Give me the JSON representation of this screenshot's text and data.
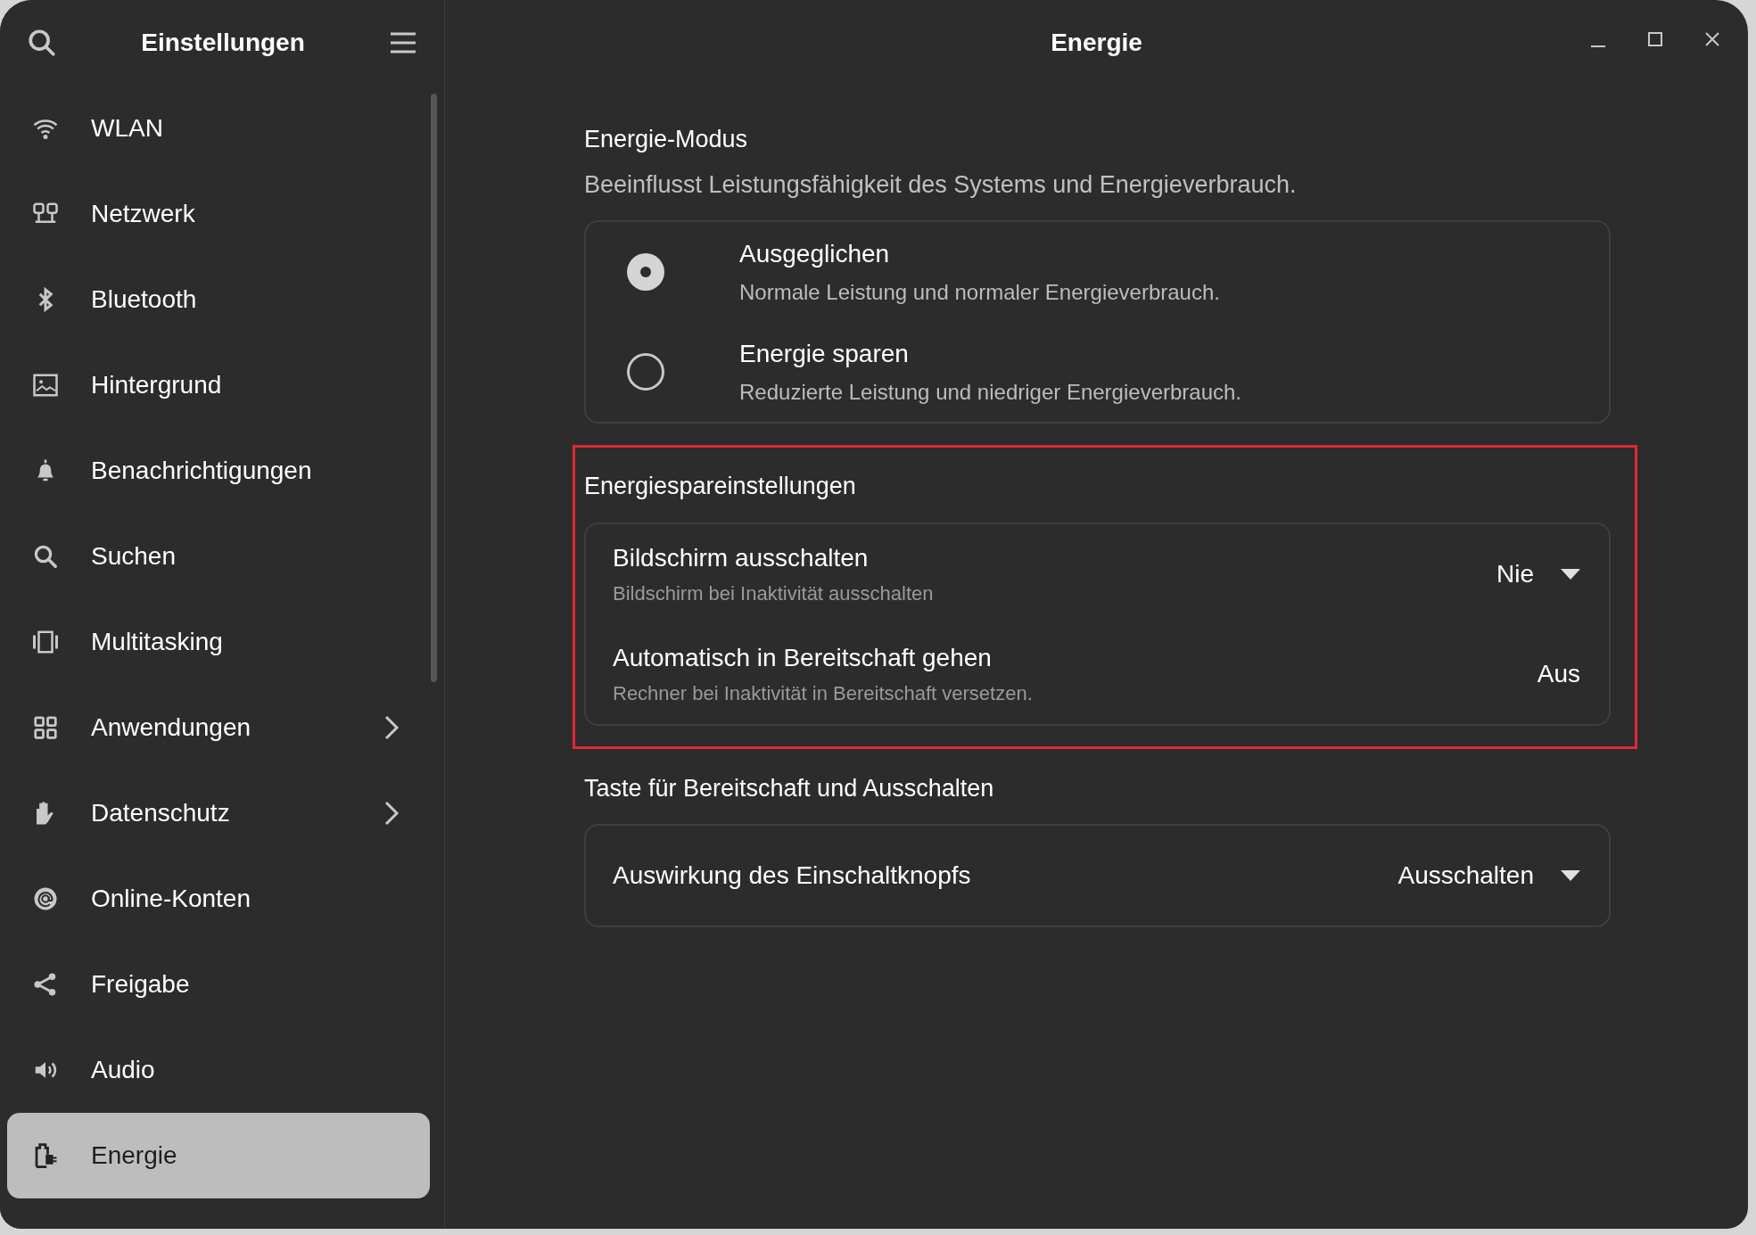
{
  "sidebar": {
    "title": "Einstellungen",
    "items": [
      {
        "label": "WLAN",
        "submenu": false,
        "selected": false
      },
      {
        "label": "Netzwerk",
        "submenu": false,
        "selected": false
      },
      {
        "label": "Bluetooth",
        "submenu": false,
        "selected": false
      },
      {
        "label": "Hintergrund",
        "submenu": false,
        "selected": false
      },
      {
        "label": "Benachrichtigungen",
        "submenu": false,
        "selected": false
      },
      {
        "label": "Suchen",
        "submenu": false,
        "selected": false
      },
      {
        "label": "Multitasking",
        "submenu": false,
        "selected": false
      },
      {
        "label": "Anwendungen",
        "submenu": true,
        "selected": false
      },
      {
        "label": "Datenschutz",
        "submenu": true,
        "selected": false
      },
      {
        "label": "Online-Konten",
        "submenu": false,
        "selected": false
      },
      {
        "label": "Freigabe",
        "submenu": false,
        "selected": false
      },
      {
        "label": "Audio",
        "submenu": false,
        "selected": false
      },
      {
        "label": "Energie",
        "submenu": false,
        "selected": true
      }
    ]
  },
  "main": {
    "title": "Energie",
    "sections": [
      {
        "kind": "radio",
        "heading": "Energie-Modus",
        "description": "Beeinflusst Leistungsfähigkeit des Systems und Energieverbrauch.",
        "highlighted": false,
        "options": [
          {
            "title": "Ausgeglichen",
            "subtitle": "Normale Leistung und normaler Energieverbrauch.",
            "selected": true
          },
          {
            "title": "Energie sparen",
            "subtitle": "Reduzierte Leistung und niedriger Energieverbrauch.",
            "selected": false
          }
        ]
      },
      {
        "kind": "rows",
        "heading": "Energiespareinstellungen",
        "highlighted": true,
        "rows": [
          {
            "title": "Bildschirm ausschalten",
            "subtitle": "Bildschirm bei Inaktivität ausschalten",
            "value": "Nie",
            "dropdown": true
          },
          {
            "title": "Automatisch in Bereitschaft gehen",
            "subtitle": "Rechner bei Inaktivität in Bereitschaft versetzen.",
            "value": "Aus",
            "dropdown": false
          }
        ]
      },
      {
        "kind": "rows",
        "heading": "Taste für Bereitschaft und Ausschalten",
        "highlighted": false,
        "rows": [
          {
            "title": "Auswirkung des Einschaltknopfs",
            "value": "Ausschalten",
            "dropdown": true
          }
        ]
      }
    ]
  }
}
